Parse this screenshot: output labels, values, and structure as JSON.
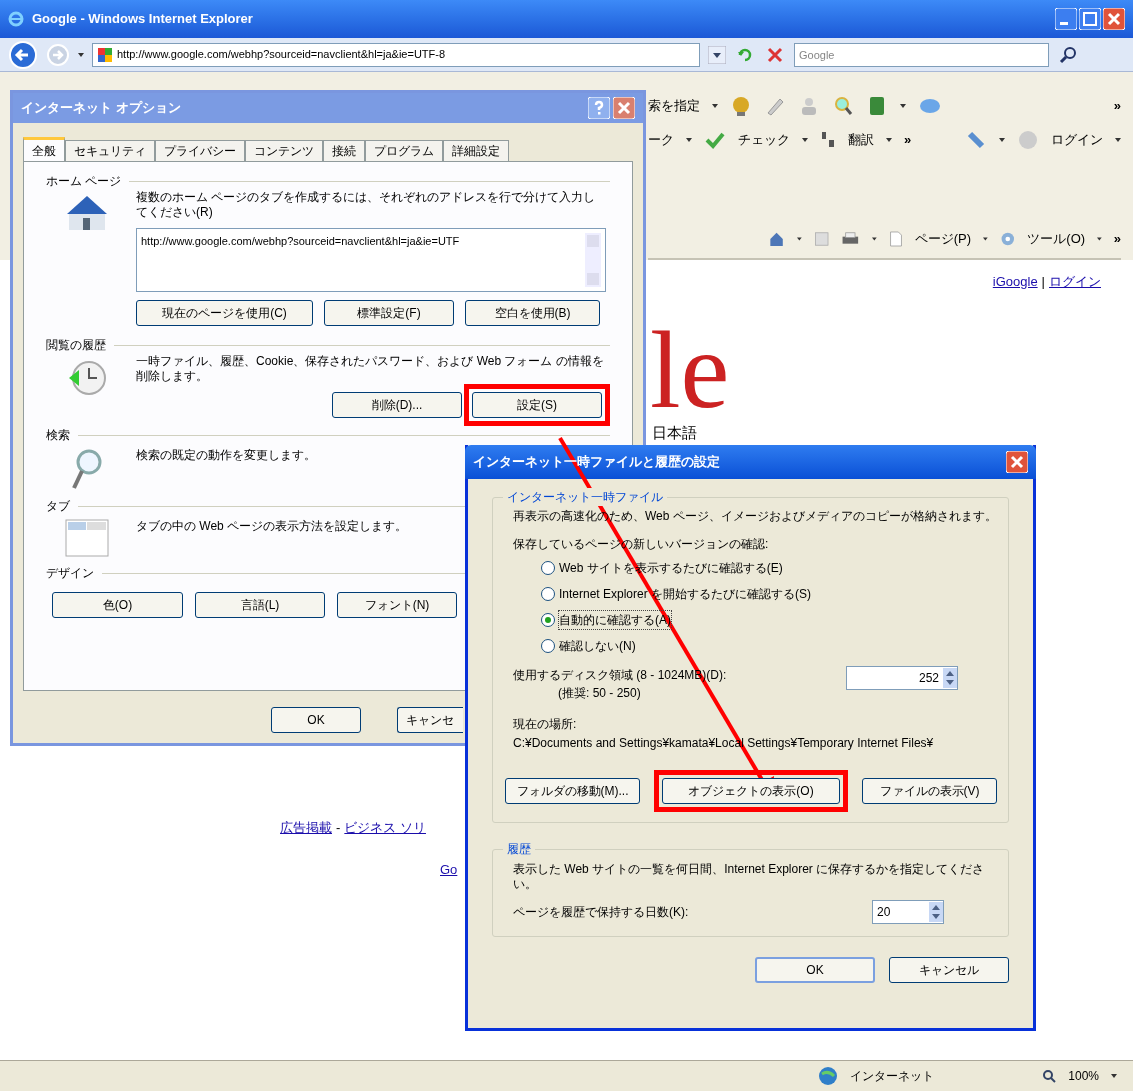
{
  "browser": {
    "title": "Google - Windows Internet Explorer",
    "address": "http://www.google.com/webhp?sourceid=navclient&hl=ja&ie=UTF-8",
    "search_placeholder": "Google",
    "toolbar_row_1": {
      "label": "索を指定",
      "more": "»"
    },
    "toolbar_row_2": {
      "items": [
        "ーク",
        "チェック",
        "翻訳"
      ],
      "more": "»",
      "login": "ログイン"
    },
    "command_bar": {
      "items": [
        "ページ(P)",
        "ツール(O)"
      ],
      "more": "»"
    },
    "page": {
      "top_links": [
        {
          "kind": "link",
          "text": "iGoogle"
        },
        {
          "kind": "text",
          "text": "|"
        },
        {
          "kind": "link",
          "text": "ログイン"
        }
      ],
      "logo": "le",
      "logo_sub": "日本語",
      "footer_line": [
        {
          "kind": "link",
          "text": "広告掲載"
        },
        {
          "kind": "text",
          "text": "-"
        },
        {
          "kind": "link",
          "text": "ビジネス ソリ"
        }
      ],
      "footer_fragment": "Go"
    },
    "status_bar": {
      "zone": "インターネット",
      "zoom": "100%"
    }
  },
  "options_dialog": {
    "title": "インターネット オプション",
    "tabs": [
      {
        "label": "全般",
        "selected": true
      },
      {
        "label": "セキュリティ",
        "selected": false
      },
      {
        "label": "プライバシー",
        "selected": false
      },
      {
        "label": "コンテンツ",
        "selected": false
      },
      {
        "label": "接続",
        "selected": false
      },
      {
        "label": "プログラム",
        "selected": false
      },
      {
        "label": "詳細設定",
        "selected": false
      }
    ],
    "sections": [
      {
        "kind": "home",
        "heading": "ホーム ページ",
        "text": "複数のホーム ページのタブを作成するには、それぞれのアドレスを行で分けて入力してください(R)",
        "field_value": "http://www.google.com/webhp?sourceid=navclient&hl=ja&ie=UTF",
        "buttons": [
          {
            "label": "現在のページを使用(C)",
            "highlighted": false
          },
          {
            "label": "標準設定(F)",
            "highlighted": false
          },
          {
            "label": "空白を使用(B)",
            "highlighted": false
          }
        ]
      },
      {
        "kind": "history",
        "heading": "閲覧の履歴",
        "text": "一時ファイル、履歴、Cookie、保存されたパスワード、および Web フォーム の情報を削除します。",
        "buttons": [
          {
            "label": "削除(D)...",
            "highlighted": false
          },
          {
            "label": "設定(S)",
            "highlighted": true
          }
        ]
      },
      {
        "kind": "search",
        "heading": "検索",
        "text": "検索の既定の動作を変更します。"
      },
      {
        "kind": "tabs",
        "heading": "タブ",
        "text": "タブの中の Web ページの表示方法を設定します。"
      },
      {
        "kind": "design",
        "heading": "デザイン",
        "buttons": [
          {
            "label": "色(O)",
            "highlighted": false
          },
          {
            "label": "言語(L)",
            "highlighted": false
          },
          {
            "label": "フォント(N)",
            "highlighted": false
          }
        ]
      }
    ],
    "buttons": [
      "OK",
      "キャンセ"
    ]
  },
  "cache_dialog": {
    "title": "インターネット一時ファイルと履歴の設定",
    "cache_group": {
      "heading": "インターネット一時ファイル",
      "description": "再表示の高速化のため、Web ページ、イメージおよびメディアのコピーが格納されます。",
      "check_label": "保存しているページの新しいバージョンの確認:",
      "options": [
        {
          "label": "Web サイトを表示するたびに確認する(E)",
          "selected": false
        },
        {
          "label": "Internet Explorer を開始するたびに確認する(S)",
          "selected": false
        },
        {
          "label": "自動的に確認する(A)",
          "selected": true
        },
        {
          "label": "確認しない(N)",
          "selected": false
        }
      ],
      "disk_label": "使用するディスク領域 (8 - 1024MB)(D):",
      "disk_hint": "(推奨: 50 - 250)",
      "disk_value": "252",
      "location_label": "現在の場所:",
      "location_path": "C:¥Documents and Settings¥kamata¥Local Settings¥Temporary Internet Files¥",
      "buttons": [
        {
          "label": "フォルダの移動(M)...",
          "highlighted": false
        },
        {
          "label": "オブジェクトの表示(O)",
          "highlighted": true
        },
        {
          "label": "ファイルの表示(V)",
          "highlighted": false
        }
      ]
    },
    "history_group": {
      "heading": "履歴",
      "description": "表示した Web サイトの一覧を何日間、Internet Explorer に保存するかを指定してください。",
      "days_label": "ページを履歴で保持する日数(K):",
      "days_value": "20"
    },
    "buttons": [
      "OK",
      "キャンセル"
    ]
  }
}
